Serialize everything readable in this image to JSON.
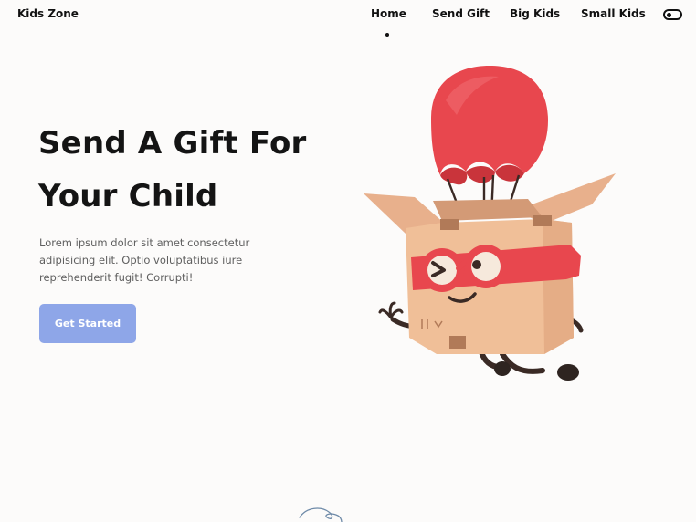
{
  "header": {
    "logo": "Kids Zone",
    "nav": [
      {
        "label": "Home",
        "active": true
      },
      {
        "label": "Send Gift"
      },
      {
        "label": "Big Kids"
      },
      {
        "label": "Small Kids"
      }
    ]
  },
  "hero": {
    "title": "Send A Gift For Your Child",
    "description": "Lorem ipsum dolor sit amet consectetur adipisicing elit. Optio voluptatibus iure reprehenderit fugit! Corrupti!",
    "cta_label": "Get Started"
  },
  "colors": {
    "background": "#fcfbfa",
    "cta": "#8ea6e8",
    "balloon": "#e8474e",
    "box": "#f0bf98"
  },
  "icons": {
    "theme_toggle": "toggle-icon",
    "illustration": "parachute-gift-box",
    "scroll": "curl-squiggle-icon"
  }
}
